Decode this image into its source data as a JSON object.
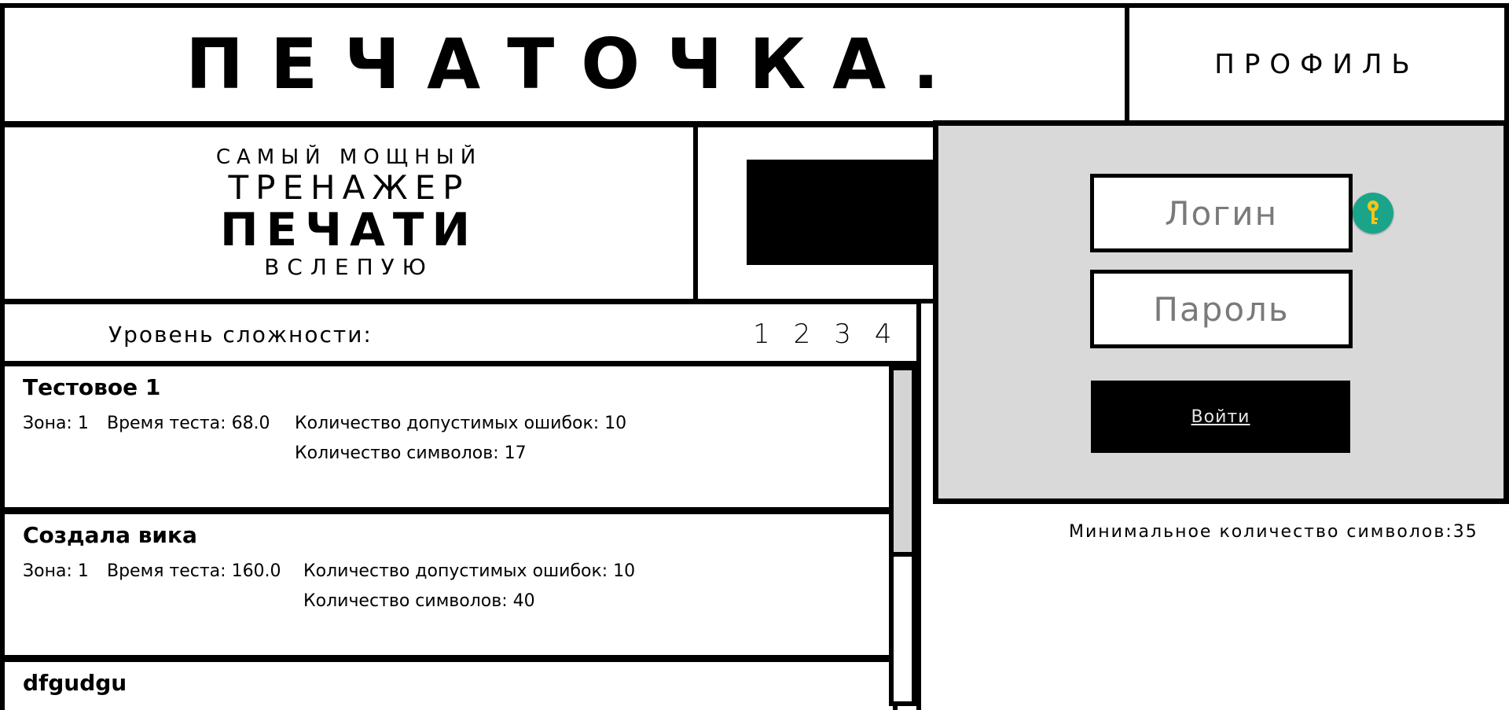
{
  "header": {
    "title": "ПЕЧАТОЧКА.",
    "profile_label": "ПРОФИЛЬ"
  },
  "slogan": {
    "line1": "САМЫЙ МОЩНЫЙ",
    "line2": "ТРЕНАЖЕР",
    "line3": "ПЕЧАТИ",
    "line4": "ВСЛЕПУЮ"
  },
  "difficulty": {
    "label": "Уровень сложности:",
    "levels": [
      "1",
      "2",
      "3",
      "4"
    ]
  },
  "tests": [
    {
      "title": "Тестовое 1",
      "zone": "Зона: 1",
      "time": "Время теста: 68.0",
      "errors": "Количество допустимых ошибок: 10",
      "chars": "Количество символов: 17"
    },
    {
      "title": "Создала вика",
      "zone": "Зона: 1",
      "time": "Время теста: 160.0",
      "errors": "Количество допустимых ошибок: 10",
      "chars": "Количество символов: 40"
    },
    {
      "title": "dfgudgu"
    }
  ],
  "login": {
    "login_placeholder": "Логин",
    "password_placeholder": "Пароль",
    "submit_label": "Войти"
  },
  "min_chars_text": "Минимальное количество символов:35",
  "colors": {
    "panel_bg": "#d9d9d9",
    "key_icon_bg": "#1aa58a",
    "key_icon_fg": "#f5c518"
  }
}
